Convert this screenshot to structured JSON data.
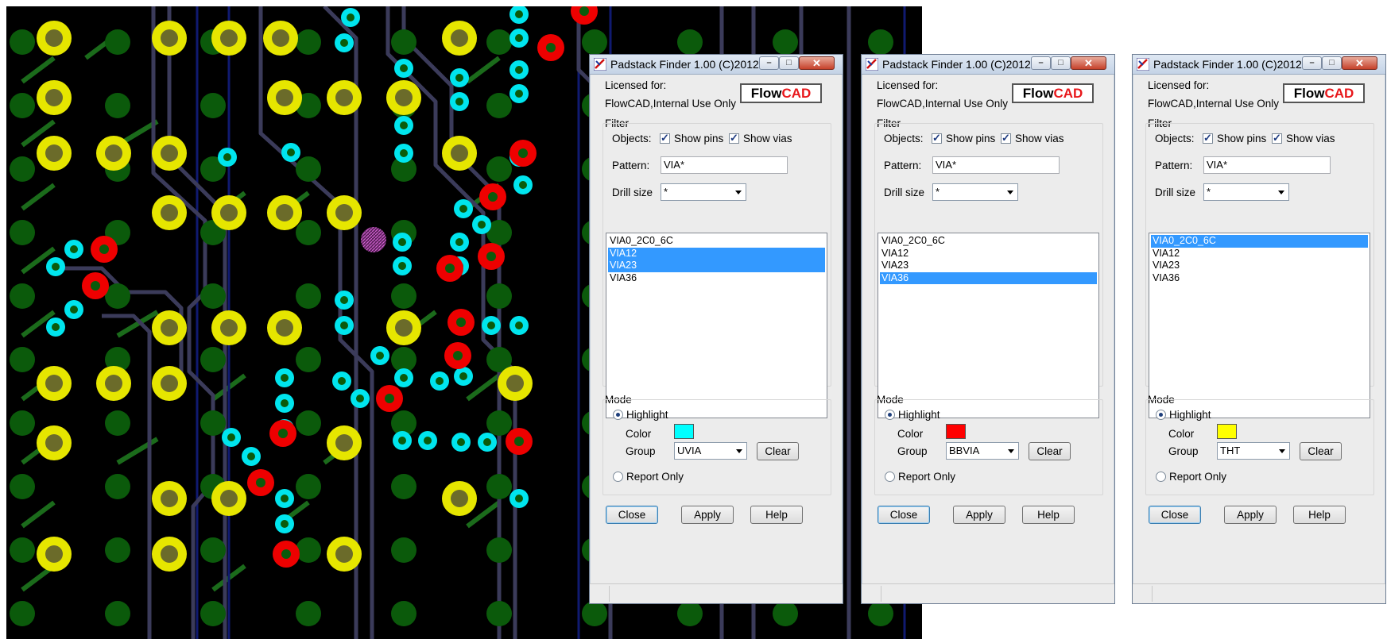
{
  "canvas": {
    "colors": {
      "background": "#000000",
      "trace": "#3b3b5a",
      "trace_green": "#1b6b1b",
      "trace_blue": "#101a70",
      "pin_yellow": "#e6e600",
      "pin_center": "#6b6b2a",
      "pad_green": "#0b5a0b",
      "via_cyan": "#00e5ee",
      "via_red": "#ee0000",
      "highlight_pattern": "#c040c0"
    }
  },
  "dialogs": [
    {
      "title": "Padstack Finder 1.00 (C)2012",
      "licensed_label": "Licensed for:",
      "licensee": "FlowCAD,Internal Use Only",
      "logo": {
        "flow": "Flow",
        "cad": "CAD"
      },
      "filter_label": "Filter",
      "objects_label": "Objects:",
      "show_pins": {
        "label": "Show pins",
        "checked": true
      },
      "show_vias": {
        "label": "Show vias",
        "checked": true
      },
      "pattern_label": "Pattern:",
      "pattern_value": "VIA*",
      "drill_label": "Drill size",
      "drill_value": "*",
      "items": [
        {
          "label": "VIA0_2C0_6C",
          "selected": false
        },
        {
          "label": "VIA12",
          "selected": true
        },
        {
          "label": "VIA23",
          "selected": true
        },
        {
          "label": "VIA36",
          "selected": false
        }
      ],
      "mode_label": "Mode",
      "highlight_label": "Highlight",
      "highlight_selected": true,
      "color_label": "Color",
      "color_value": "#00ffff",
      "group_label": "Group",
      "group_value": "UVIA",
      "clear_label": "Clear",
      "report_label": "Report Only",
      "close_label": "Close",
      "apply_label": "Apply",
      "help_label": "Help"
    },
    {
      "title": "Padstack Finder 1.00 (C)2012",
      "licensed_label": "Licensed for:",
      "licensee": "FlowCAD,Internal Use Only",
      "logo": {
        "flow": "Flow",
        "cad": "CAD"
      },
      "filter_label": "Filter",
      "objects_label": "Objects:",
      "show_pins": {
        "label": "Show pins",
        "checked": true
      },
      "show_vias": {
        "label": "Show vias",
        "checked": true
      },
      "pattern_label": "Pattern:",
      "pattern_value": "VIA*",
      "drill_label": "Drill size",
      "drill_value": "*",
      "items": [
        {
          "label": "VIA0_2C0_6C",
          "selected": false
        },
        {
          "label": "VIA12",
          "selected": false
        },
        {
          "label": "VIA23",
          "selected": false
        },
        {
          "label": "VIA36",
          "selected": true
        }
      ],
      "mode_label": "Mode",
      "highlight_label": "Highlight",
      "highlight_selected": true,
      "color_label": "Color",
      "color_value": "#ff0000",
      "group_label": "Group",
      "group_value": "BBVIA",
      "clear_label": "Clear",
      "report_label": "Report Only",
      "close_label": "Close",
      "apply_label": "Apply",
      "help_label": "Help"
    },
    {
      "title": "Padstack Finder 1.00 (C)2012",
      "licensed_label": "Licensed for:",
      "licensee": "FlowCAD,Internal Use Only",
      "logo": {
        "flow": "Flow",
        "cad": "CAD"
      },
      "filter_label": "Filter",
      "objects_label": "Objects:",
      "show_pins": {
        "label": "Show pins",
        "checked": true
      },
      "show_vias": {
        "label": "Show vias",
        "checked": true
      },
      "pattern_label": "Pattern:",
      "pattern_value": "VIA*",
      "drill_label": "Drill size",
      "drill_value": "*",
      "items": [
        {
          "label": "VIA0_2C0_6C",
          "selected": true
        },
        {
          "label": "VIA12",
          "selected": false
        },
        {
          "label": "VIA23",
          "selected": false
        },
        {
          "label": "VIA36",
          "selected": false
        }
      ],
      "mode_label": "Mode",
      "highlight_label": "Highlight",
      "highlight_selected": true,
      "color_label": "Color",
      "color_value": "#ffff00",
      "group_label": "Group",
      "group_value": "THT",
      "clear_label": "Clear",
      "report_label": "Report Only",
      "close_label": "Close",
      "apply_label": "Apply",
      "help_label": "Help"
    }
  ]
}
